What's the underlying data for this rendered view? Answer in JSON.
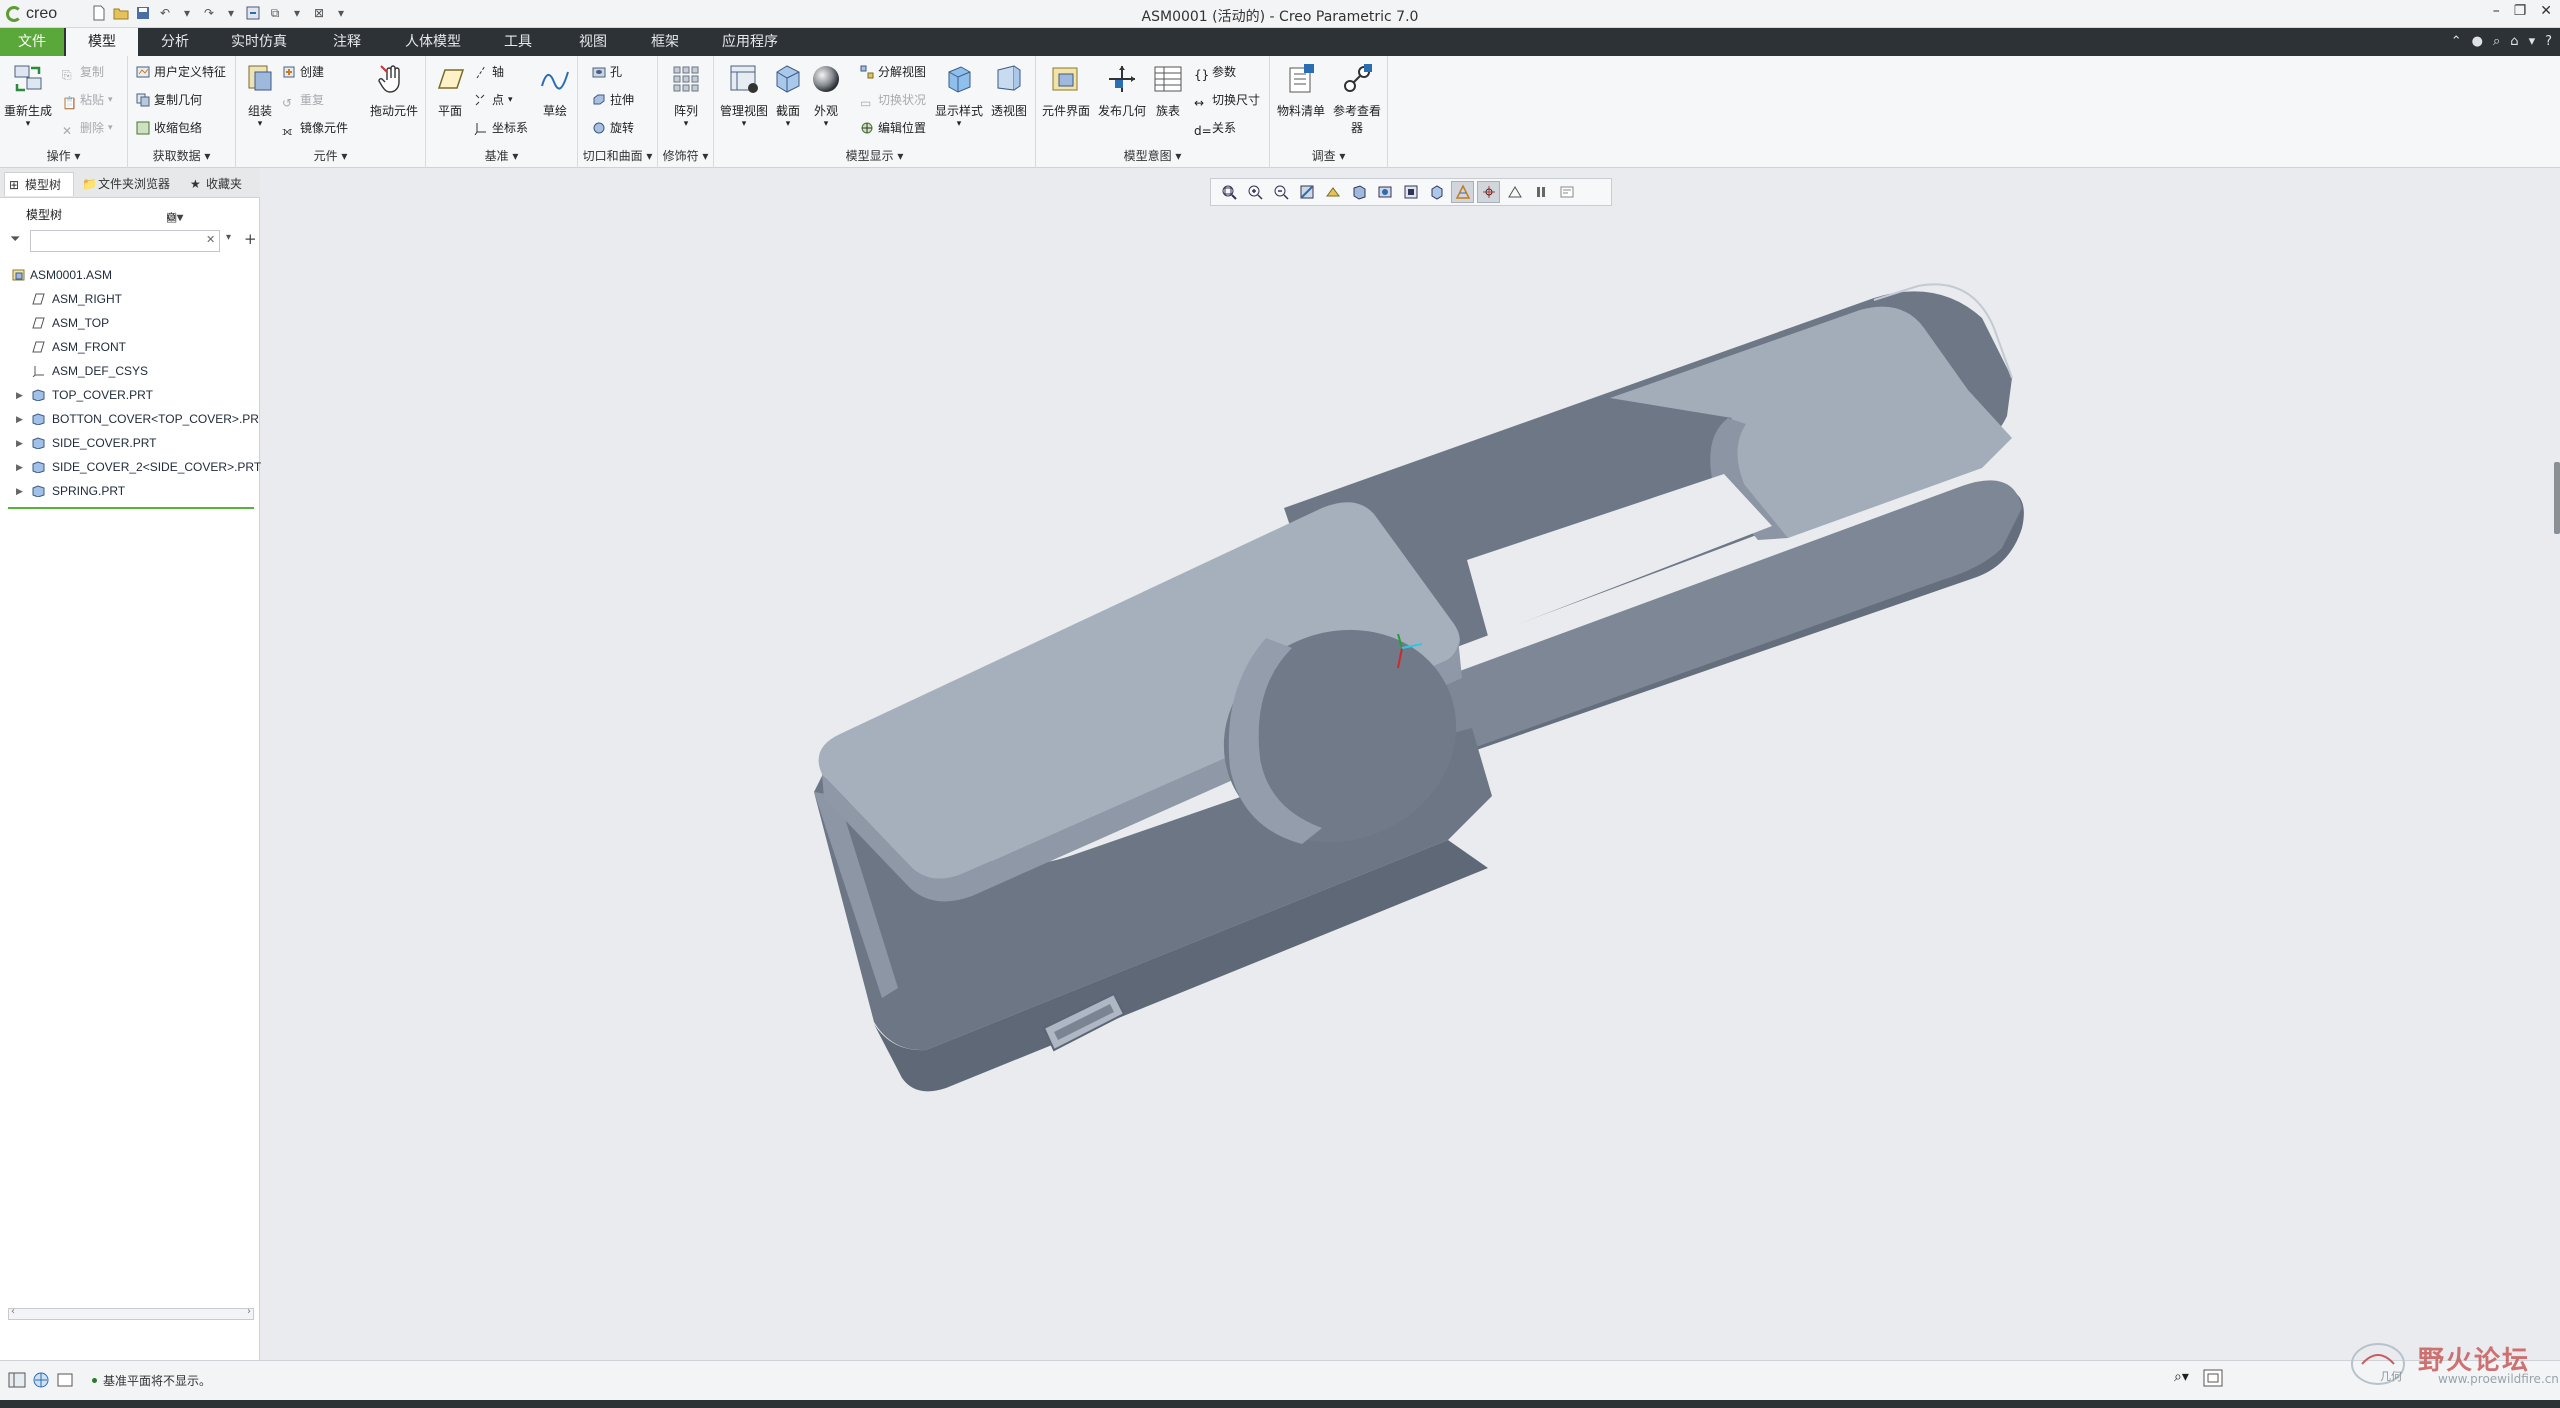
{
  "window": {
    "app_name": "creo",
    "title": "ASM0001 (活动的) - Creo Parametric 7.0"
  },
  "tabs": [
    "文件",
    "模型",
    "分析",
    "实时仿真",
    "注释",
    "人体模型",
    "工具",
    "视图",
    "框架",
    "应用程序"
  ],
  "ribbon": {
    "operations": {
      "label": "操作",
      "regenerate": "重新生成",
      "copy": "复制",
      "paste": "粘贴",
      "delete": "删除"
    },
    "get_data": {
      "label": "获取数据",
      "udf": "用户定义特征",
      "copy_geom": "复制几何",
      "shrinkwrap": "收缩包络"
    },
    "component": {
      "label": "元件",
      "assemble": "组装",
      "create": "创建",
      "repeat": "重复",
      "mirror": "镜像元件",
      "drag": "拖动元件"
    },
    "datum": {
      "label": "基准",
      "plane": "平面",
      "axis": "轴",
      "point": "点",
      "csys": "坐标系",
      "sketch": "草绘"
    },
    "cut_surface": {
      "label": "切口和曲面",
      "hole": "孔",
      "extrude": "拉伸",
      "revolve": "旋转"
    },
    "modifiers": {
      "label": "修饰符",
      "pattern": "阵列"
    },
    "model_display": {
      "label": "模型显示",
      "manage_views": "管理视图",
      "section": "截面",
      "appearance": "外观",
      "explode": "分解视图",
      "toggle_status": "切换状况",
      "edit_position": "编辑位置",
      "display_style": "显示样式",
      "perspective": "透视图"
    },
    "model_intent": {
      "label": "模型意图",
      "component_interface": "元件界面",
      "publish_geom": "发布几何",
      "family_table": "族表",
      "parameters": "参数",
      "switch_dims": "切换尺寸",
      "relations": "关系"
    },
    "investigate": {
      "label": "调查",
      "bom": "物料清单",
      "reference_viewer_1": "参考查看",
      "reference_viewer_2": "器"
    }
  },
  "left_panel": {
    "tabs": [
      "模型树",
      "文件夹浏览器",
      "收藏夹"
    ],
    "header": "模型树",
    "filter_placeholder": "",
    "tree": [
      {
        "label": "ASM0001.ASM",
        "type": "asm",
        "expandable": false
      },
      {
        "label": "ASM_RIGHT",
        "type": "plane",
        "expandable": false
      },
      {
        "label": "ASM_TOP",
        "type": "plane",
        "expandable": false
      },
      {
        "label": "ASM_FRONT",
        "type": "plane",
        "expandable": false
      },
      {
        "label": "ASM_DEF_CSYS",
        "type": "csys",
        "expandable": false
      },
      {
        "label": "TOP_COVER.PRT",
        "type": "part",
        "expandable": true
      },
      {
        "label": "BOTTON_COVER<TOP_COVER>.PR",
        "type": "part",
        "expandable": true
      },
      {
        "label": "SIDE_COVER.PRT",
        "type": "part",
        "expandable": true
      },
      {
        "label": "SIDE_COVER_2<SIDE_COVER>.PRT",
        "type": "part",
        "expandable": true
      },
      {
        "label": "SPRING.PRT",
        "type": "part",
        "expandable": true
      }
    ]
  },
  "status": {
    "message": "基准平面将不显示。"
  },
  "watermark": {
    "text": "野火论坛",
    "sub": "www.proewildfire.cn",
    "badge": "几何"
  },
  "colors": {
    "accent_green": "#5aa83a",
    "tabbar_bg": "#2c3236",
    "model_light": "#a6b0bd",
    "model_dark": "#7a8391"
  }
}
